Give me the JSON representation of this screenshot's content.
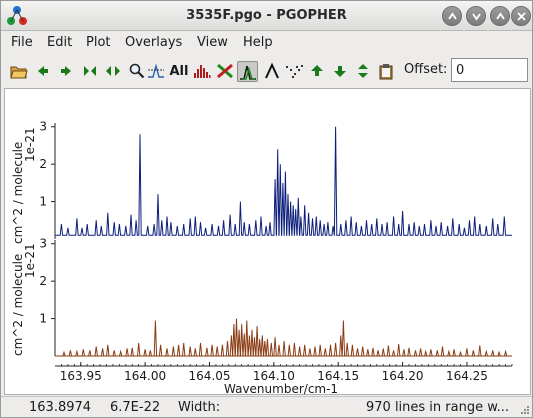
{
  "window": {
    "title": "3535F.pgo - PGOPHER"
  },
  "menu": [
    "File",
    "Edit",
    "Plot",
    "Overlays",
    "View",
    "Help"
  ],
  "toolbar": {
    "all_label": "All",
    "offset_label": "Offset:",
    "offset_value": "0",
    "icons": [
      "open-folder-icon",
      "arrow-left-icon",
      "arrow-right-icon",
      "shrink-icon",
      "expand-icon",
      "zoom-icon",
      "peak-fit-icon",
      "all-button",
      "bar-spectrum-icon",
      "red-green-x-icon",
      "overlay-peaks-icon",
      "lambda-peak-icon",
      "scatter-dots-icon",
      "arrow-up-icon",
      "arrow-down-icon",
      "up-down-icon",
      "clipboard-icon"
    ]
  },
  "status": {
    "position": "163.8974",
    "intensity": "6.7E-22",
    "width_label": "Width:",
    "lines_info": "970 lines in range w..."
  },
  "chart_data": {
    "type": "line",
    "xlabel": "Wavenumber/cm-1",
    "xlim": [
      163.93,
      164.285
    ],
    "x_ticks": [
      163.95,
      164.0,
      164.05,
      164.1,
      164.15,
      164.2,
      164.25
    ],
    "x_tick_labels": [
      "163.95",
      "164.00",
      "164.05",
      "164.10",
      "164.15",
      "164.20",
      "164.25"
    ],
    "panels": [
      {
        "name": "upper",
        "ylabel": "cm^2 / molecule",
        "yexponent": "1e-21",
        "ylim": [
          0,
          3.1
        ],
        "y_ticks": [
          1,
          2,
          3
        ],
        "color": "#0d1f7a",
        "baseline": 0.1,
        "peaks": [
          [
            163.935,
            0.4
          ],
          [
            163.94,
            0.3
          ],
          [
            163.947,
            0.55
          ],
          [
            163.951,
            0.3
          ],
          [
            163.955,
            0.4
          ],
          [
            163.962,
            0.5
          ],
          [
            163.966,
            0.35
          ],
          [
            163.971,
            0.7
          ],
          [
            163.976,
            0.45
          ],
          [
            163.98,
            0.4
          ],
          [
            163.985,
            0.35
          ],
          [
            163.989,
            0.65
          ],
          [
            163.993,
            0.5
          ],
          [
            163.996,
            2.8
          ],
          [
            164.002,
            0.35
          ],
          [
            164.007,
            0.4
          ],
          [
            164.01,
            1.2
          ],
          [
            164.013,
            0.5
          ],
          [
            164.017,
            0.6
          ],
          [
            164.02,
            0.45
          ],
          [
            164.025,
            0.35
          ],
          [
            164.03,
            0.4
          ],
          [
            164.035,
            0.55
          ],
          [
            164.039,
            0.6
          ],
          [
            164.043,
            0.45
          ],
          [
            164.047,
            0.3
          ],
          [
            164.052,
            0.4
          ],
          [
            164.057,
            0.35
          ],
          [
            164.061,
            0.5
          ],
          [
            164.066,
            0.65
          ],
          [
            164.07,
            0.4
          ],
          [
            164.074,
            1.0
          ],
          [
            164.077,
            0.45
          ],
          [
            164.081,
            0.4
          ],
          [
            164.086,
            0.5
          ],
          [
            164.09,
            0.6
          ],
          [
            164.094,
            0.35
          ],
          [
            164.097,
            0.45
          ],
          [
            164.101,
            1.6
          ],
          [
            164.103,
            2.4
          ],
          [
            164.105,
            2.0
          ],
          [
            164.107,
            1.5
          ],
          [
            164.109,
            1.8
          ],
          [
            164.111,
            1.2
          ],
          [
            164.113,
            1.0
          ],
          [
            164.115,
            0.9
          ],
          [
            164.117,
            0.8
          ],
          [
            164.119,
            1.1
          ],
          [
            164.121,
            0.6
          ],
          [
            164.124,
            0.9
          ],
          [
            164.127,
            0.7
          ],
          [
            164.13,
            0.55
          ],
          [
            164.133,
            0.6
          ],
          [
            164.136,
            0.5
          ],
          [
            164.139,
            0.4
          ],
          [
            164.142,
            0.45
          ],
          [
            164.146,
            0.35
          ],
          [
            164.148,
            3.0
          ],
          [
            164.152,
            0.4
          ],
          [
            164.156,
            0.5
          ],
          [
            164.16,
            0.6
          ],
          [
            164.164,
            0.45
          ],
          [
            164.168,
            0.35
          ],
          [
            164.172,
            0.5
          ],
          [
            164.176,
            0.4
          ],
          [
            164.18,
            0.55
          ],
          [
            164.184,
            0.4
          ],
          [
            164.188,
            0.45
          ],
          [
            164.193,
            0.6
          ],
          [
            164.197,
            0.4
          ],
          [
            164.2,
            0.75
          ],
          [
            164.205,
            0.4
          ],
          [
            164.209,
            0.45
          ],
          [
            164.213,
            0.35
          ],
          [
            164.217,
            0.4
          ],
          [
            164.222,
            0.5
          ],
          [
            164.226,
            0.35
          ],
          [
            164.23,
            0.45
          ],
          [
            164.235,
            0.35
          ],
          [
            164.239,
            0.55
          ],
          [
            164.244,
            0.4
          ],
          [
            164.248,
            0.3
          ],
          [
            164.252,
            0.5
          ],
          [
            164.256,
            0.6
          ],
          [
            164.26,
            0.4
          ],
          [
            164.265,
            0.35
          ],
          [
            164.27,
            0.55
          ],
          [
            164.274,
            0.4
          ],
          [
            164.279,
            0.6
          ]
        ]
      },
      {
        "name": "lower",
        "ylabel": "cm^2 / molecule",
        "yexponent": "1e-21",
        "ylim": [
          0,
          3.1
        ],
        "y_ticks": [
          1,
          2,
          3
        ],
        "color": "#8a3b12",
        "baseline": 0.0,
        "peaks": [
          [
            163.937,
            0.1
          ],
          [
            163.942,
            0.15
          ],
          [
            163.947,
            0.12
          ],
          [
            163.952,
            0.18
          ],
          [
            163.957,
            0.15
          ],
          [
            163.962,
            0.25
          ],
          [
            163.967,
            0.2
          ],
          [
            163.971,
            0.3
          ],
          [
            163.976,
            0.15
          ],
          [
            163.981,
            0.12
          ],
          [
            163.986,
            0.2
          ],
          [
            163.99,
            0.22
          ],
          [
            163.995,
            0.35
          ],
          [
            164.0,
            0.18
          ],
          [
            164.004,
            0.15
          ],
          [
            164.008,
            0.95
          ],
          [
            164.012,
            0.3
          ],
          [
            164.017,
            0.2
          ],
          [
            164.022,
            0.25
          ],
          [
            164.026,
            0.3
          ],
          [
            164.03,
            0.35
          ],
          [
            164.035,
            0.25
          ],
          [
            164.039,
            0.2
          ],
          [
            164.043,
            0.35
          ],
          [
            164.048,
            0.22
          ],
          [
            164.052,
            0.3
          ],
          [
            164.056,
            0.25
          ],
          [
            164.06,
            0.3
          ],
          [
            164.064,
            0.4
          ],
          [
            164.067,
            0.55
          ],
          [
            164.069,
            0.85
          ],
          [
            164.071,
            1.0
          ],
          [
            164.073,
            0.7
          ],
          [
            164.075,
            0.85
          ],
          [
            164.077,
            0.6
          ],
          [
            164.079,
            0.95
          ],
          [
            164.081,
            0.55
          ],
          [
            164.083,
            0.7
          ],
          [
            164.085,
            0.5
          ],
          [
            164.087,
            0.8
          ],
          [
            164.089,
            0.45
          ],
          [
            164.091,
            0.55
          ],
          [
            164.093,
            0.4
          ],
          [
            164.095,
            0.45
          ],
          [
            164.098,
            0.35
          ],
          [
            164.101,
            0.5
          ],
          [
            164.104,
            0.3
          ],
          [
            164.108,
            0.4
          ],
          [
            164.112,
            0.3
          ],
          [
            164.116,
            0.35
          ],
          [
            164.12,
            0.25
          ],
          [
            164.124,
            0.3
          ],
          [
            164.128,
            0.2
          ],
          [
            164.132,
            0.25
          ],
          [
            164.136,
            0.3
          ],
          [
            164.14,
            0.2
          ],
          [
            164.144,
            0.3
          ],
          [
            164.148,
            0.35
          ],
          [
            164.152,
            0.55
          ],
          [
            164.154,
            0.95
          ],
          [
            164.157,
            0.35
          ],
          [
            164.161,
            0.3
          ],
          [
            164.165,
            0.2
          ],
          [
            164.169,
            0.25
          ],
          [
            164.173,
            0.18
          ],
          [
            164.177,
            0.22
          ],
          [
            164.181,
            0.15
          ],
          [
            164.185,
            0.2
          ],
          [
            164.189,
            0.28
          ],
          [
            164.193,
            0.15
          ],
          [
            164.197,
            0.32
          ],
          [
            164.201,
            0.18
          ],
          [
            164.205,
            0.22
          ],
          [
            164.21,
            0.15
          ],
          [
            164.214,
            0.2
          ],
          [
            164.218,
            0.12
          ],
          [
            164.222,
            0.18
          ],
          [
            164.227,
            0.15
          ],
          [
            164.231,
            0.25
          ],
          [
            164.236,
            0.12
          ],
          [
            164.24,
            0.18
          ],
          [
            164.245,
            0.1
          ],
          [
            164.25,
            0.2
          ],
          [
            164.255,
            0.15
          ],
          [
            164.26,
            0.28
          ],
          [
            164.265,
            0.12
          ],
          [
            164.27,
            0.15
          ],
          [
            164.275,
            0.1
          ],
          [
            164.28,
            0.12
          ]
        ]
      }
    ]
  }
}
